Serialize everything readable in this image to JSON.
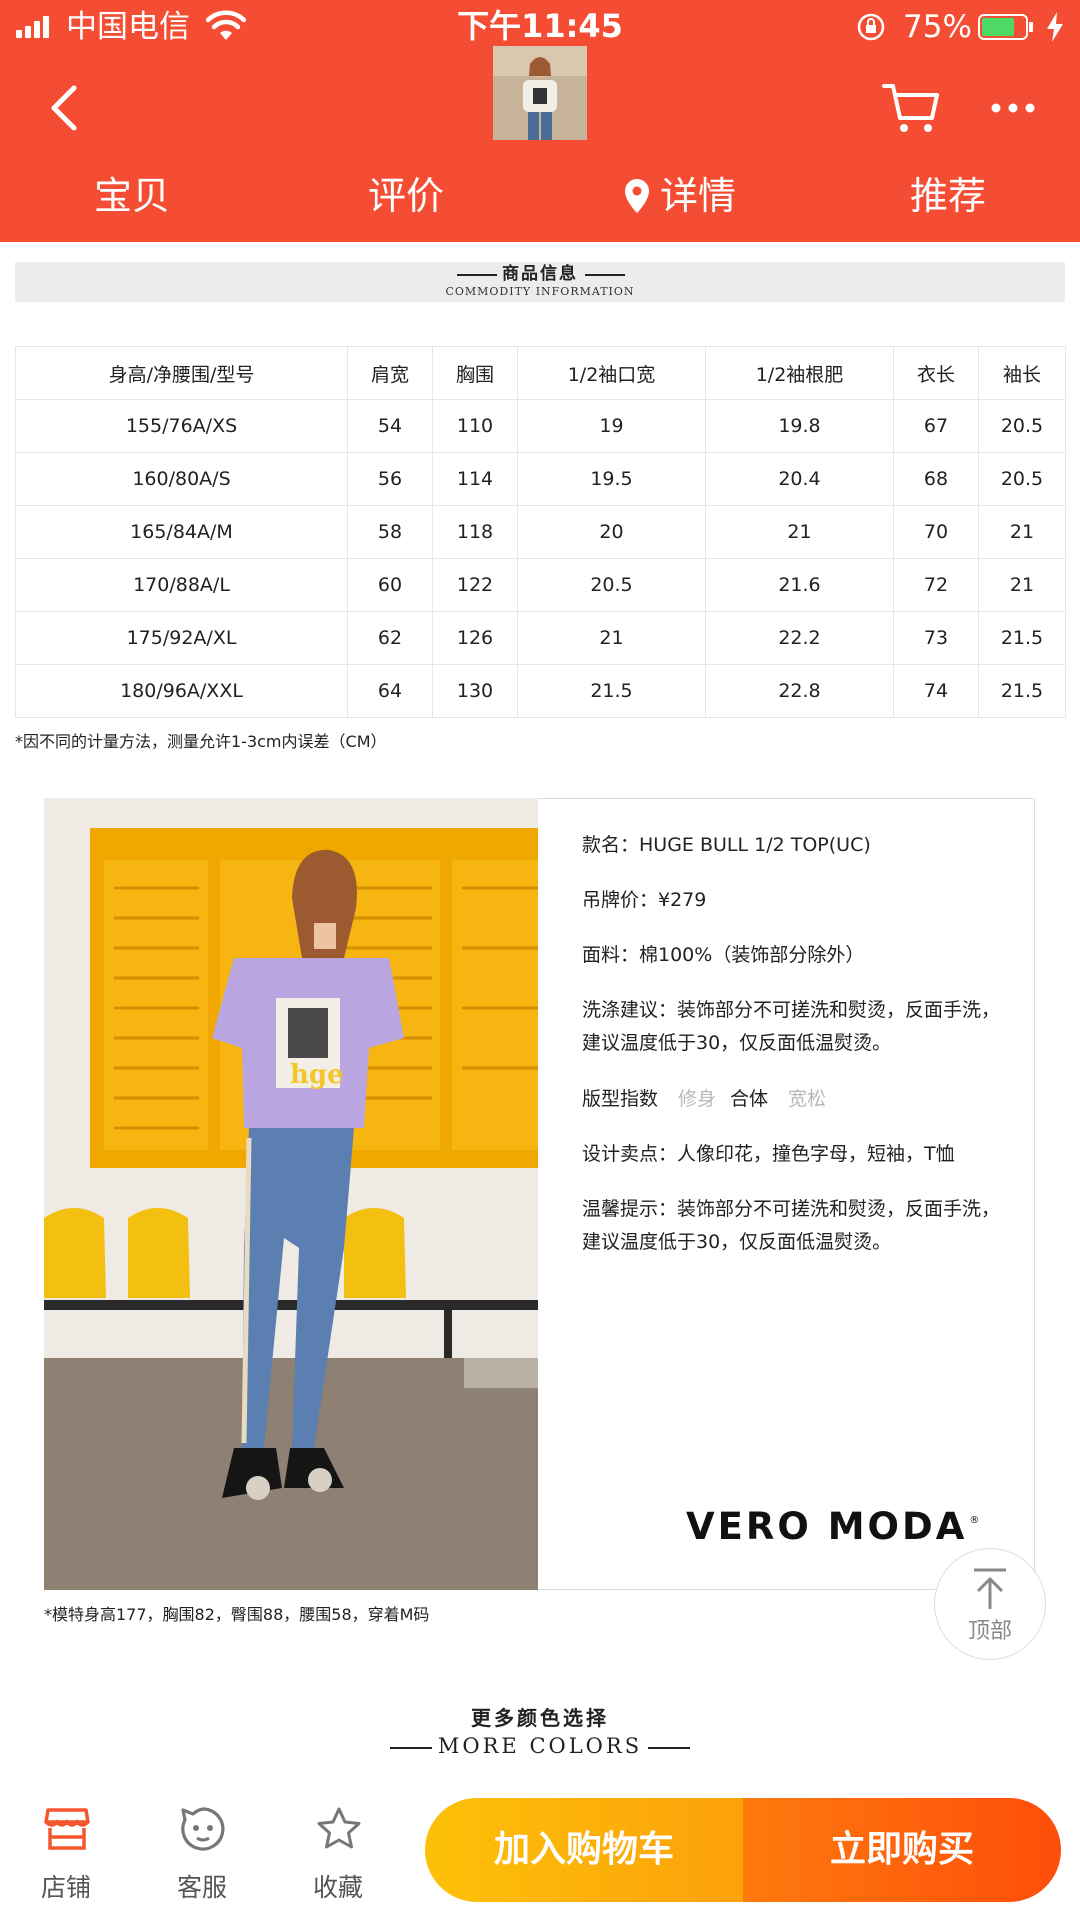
{
  "status_bar": {
    "carrier": "中国电信",
    "time": "下午11:45",
    "battery": "75%"
  },
  "nav": {
    "tabs": [
      "宝贝",
      "评价",
      "详情",
      "推荐"
    ],
    "active_tab": "详情"
  },
  "info_section": {
    "title": "商品信息",
    "subtitle": "COMMODITY INFORMATION"
  },
  "size_table": {
    "headers": [
      "身高/净腰围/型号",
      "肩宽",
      "胸围",
      "1/2袖口宽",
      "1/2袖根肥",
      "衣长",
      "袖长"
    ],
    "rows": [
      [
        "155/76A/XS",
        "54",
        "110",
        "19",
        "19.8",
        "67",
        "20.5"
      ],
      [
        "160/80A/S",
        "56",
        "114",
        "19.5",
        "20.4",
        "68",
        "20.5"
      ],
      [
        "165/84A/M",
        "58",
        "118",
        "20",
        "21",
        "70",
        "21"
      ],
      [
        "170/88A/L",
        "60",
        "122",
        "20.5",
        "21.6",
        "72",
        "21"
      ],
      [
        "175/92A/XL",
        "62",
        "126",
        "21",
        "22.2",
        "73",
        "21.5"
      ],
      [
        "180/96A/XXL",
        "64",
        "130",
        "21.5",
        "22.8",
        "74",
        "21.5"
      ]
    ],
    "note": "*因不同的计量方法，测量允许1-3cm内误差（CM）"
  },
  "details": {
    "name": "款名：HUGE BULL 1/2 TOP(UC)",
    "price": "吊牌价：¥279",
    "fabric": "面料：棉100%（装饰部分除外）",
    "wash": "洗涤建议：装饰部分不可搓洗和熨烫，反面手洗，建议温度低于30，仅反面低温熨烫。",
    "fit_label": "版型指数",
    "fit_options": [
      "修身",
      "合体",
      "宽松"
    ],
    "fit_selected": "合体",
    "selling_points": "设计卖点：人像印花，撞色字母，短袖，T恤",
    "tips": "温馨提示：装饰部分不可搓洗和熨烫，反面手洗，建议温度低于30，仅反面低温熨烫。",
    "brand": "VERO MODA",
    "brand_mark": "®"
  },
  "model_note": "*模特身高177，胸围82，臀围88，腰围58，穿着M码",
  "top_button": "顶部",
  "more_colors": {
    "cn": "更多颜色选择",
    "en": "MORE COLORS"
  },
  "bottom_bar": {
    "store": "店铺",
    "service": "客服",
    "favorite": "收藏",
    "add_to_cart": "加入购物车",
    "buy_now": "立即购买"
  },
  "colors": {
    "header": "#f44d33",
    "cart_button": "#fdc108",
    "buy_button": "#fe4d0b",
    "accent_icon": "#f5562f"
  },
  "icons": {
    "back": "chevron-left-icon",
    "cart": "shopping-cart-icon",
    "more": "more-dots-icon",
    "location": "location-pin-icon",
    "top": "arrow-up-icon",
    "store": "store-icon",
    "service": "service-face-icon",
    "favorite": "star-icon"
  }
}
